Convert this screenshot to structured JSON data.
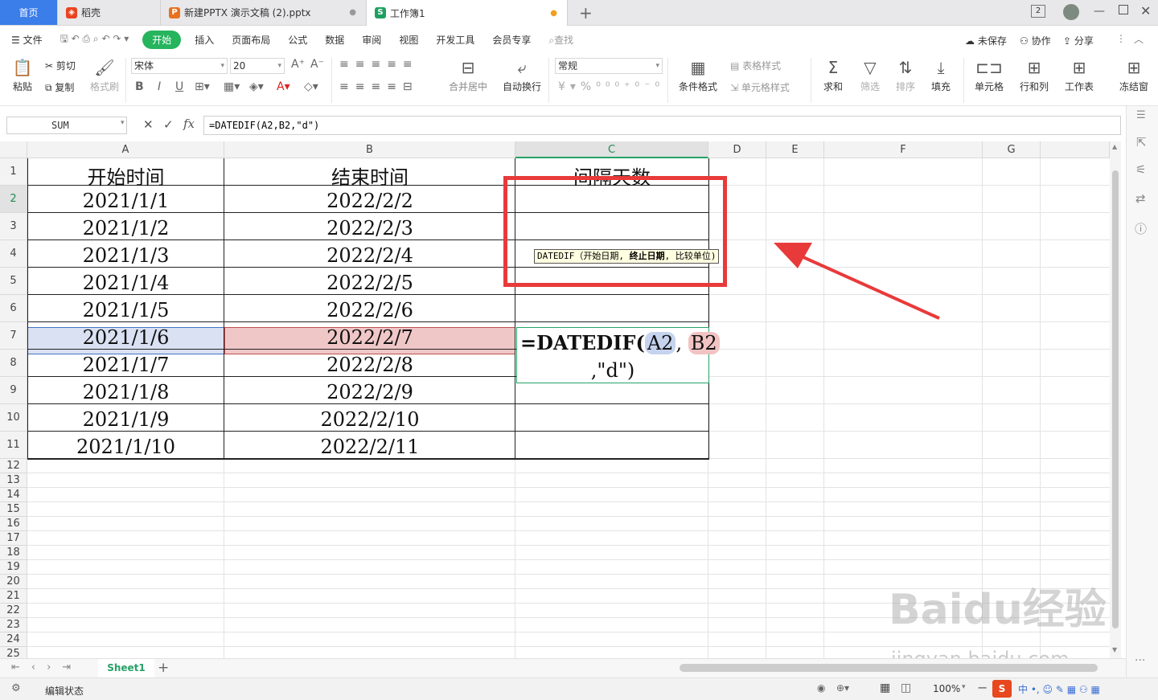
{
  "tabs": {
    "home": "首页",
    "docer": "稻壳",
    "pptx": "新建PPTX 演示文稿 (2).pptx",
    "workbook": "工作簿1",
    "add": "+"
  },
  "menu": {
    "file": "文件",
    "items": [
      "开始",
      "插入",
      "页面布局",
      "公式",
      "数据",
      "审阅",
      "视图",
      "开发工具",
      "会员专享"
    ],
    "search": "查找",
    "unsaved": "未保存",
    "collab": "协作",
    "share": "分享"
  },
  "ribbon": {
    "paste": "粘贴",
    "cut": "剪切",
    "copy": "复制",
    "format_painter": "格式刷",
    "font_name": "宋体",
    "font_size": "20",
    "merge_center": "合并居中",
    "wrap_text": "自动换行",
    "number_format": "常规",
    "conditional_format": "条件格式",
    "table_style": "表格样式",
    "cell_style": "单元格样式",
    "sum": "求和",
    "filter": "筛选",
    "sort": "排序",
    "fill": "填充",
    "cell": "单元格",
    "row_col": "行和列",
    "worksheet": "工作表",
    "freeze": "冻结窗"
  },
  "formula_bar": {
    "name_box": "SUM",
    "fx": "fx",
    "formula": "=DATEDIF(A2,B2,\"d\")"
  },
  "columns": [
    "A",
    "B",
    "C",
    "D",
    "E",
    "F",
    "G"
  ],
  "rows": [
    "1",
    "2",
    "3",
    "4",
    "5",
    "6",
    "7",
    "8",
    "9",
    "10",
    "11",
    "12",
    "13",
    "14",
    "15",
    "16",
    "17",
    "18",
    "19",
    "20",
    "21",
    "22",
    "23",
    "24",
    "25"
  ],
  "table": {
    "headers": [
      "开始时间",
      "结束时间",
      "间隔天数"
    ],
    "start_dates": [
      "2021/1/1",
      "2021/1/2",
      "2021/1/3",
      "2021/1/4",
      "2021/1/5",
      "2021/1/6",
      "2021/1/7",
      "2021/1/8",
      "2021/1/9",
      "2021/1/10"
    ],
    "end_dates": [
      "2022/2/2",
      "2022/2/3",
      "2022/2/4",
      "2022/2/5",
      "2022/2/6",
      "2022/2/7",
      "2022/2/8",
      "2022/2/9",
      "2022/2/10",
      "2022/2/11"
    ]
  },
  "editing_cell": {
    "prefix": "=DATEDIF(",
    "ref1": "A2",
    "comma": ",",
    "ref2": "B2",
    "line2": ",\"d\")"
  },
  "tooltip": {
    "func": "DATEDIF（开始日期,",
    "bold": "终止日期",
    "rest": ", 比较单位)"
  },
  "sheet": {
    "name": "Sheet1",
    "status": "编辑状态",
    "zoom": "100%"
  },
  "watermark": {
    "brand": "Baidu经验",
    "url": "jingyan.baidu.com"
  },
  "colors": {
    "accent_green": "#26b45d",
    "highlight_red": "#e83a3a",
    "a2_fill": "#d9e1f2",
    "b2_fill": "#f0c7c7"
  }
}
